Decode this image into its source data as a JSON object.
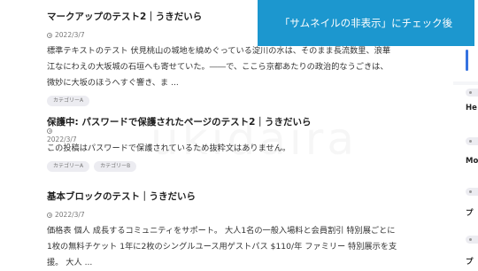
{
  "posts": [
    {
      "title": "マークアップのテスト2｜うきだいら",
      "date": "2022/3/7",
      "excerpt": [
        "標準テキストのテスト 伏見桃山の城地を繞めぐっている淀川の水は、そのまま長流数里、浪華",
        "江なにわえの大坂城の石垣へも寄せていた。――で、ここら京都あたりの政治的なうごきは、",
        "微妙に大坂のほうへすぐ響き、ま ..."
      ],
      "categories": [
        "カテゴリーA"
      ]
    },
    {
      "title": "保護中: パスワードで保護されたページのテスト2｜うきだいら",
      "date": "2022/3/7",
      "excerpt": [
        "この投稿はパスワードで保護されているため抜粋文はありません。"
      ],
      "categories": [
        "カテゴリーA",
        "カテゴリーB"
      ]
    },
    {
      "title": "基本ブロックのテスト｜うきだいら",
      "date": "2022/3/7",
      "excerpt": [
        "価格表 個人 成長するコミュニティをサポート。 大人1名の一般入場料と会員割引 特別展ごとに",
        "1枚の無料チケット 1年に2枚のシングルユース用ゲストパス $110/年 ファミリー 特別展示を支",
        "援。 大人 ..."
      ],
      "categories": []
    }
  ],
  "watermark": "ukidaira",
  "banner": {
    "text": "「サムネイルの非表示」にチェック後"
  },
  "sidebar": {
    "texts": [
      "He",
      "Mo",
      "プ",
      "プ"
    ]
  },
  "colors": {
    "banner": "#1c97cf",
    "accent": "#3572e0"
  }
}
